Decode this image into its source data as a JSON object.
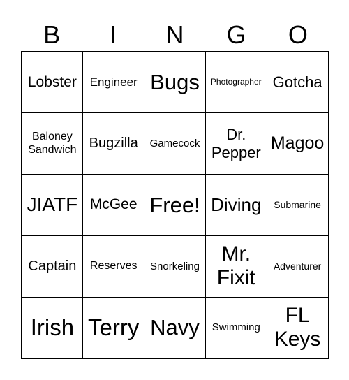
{
  "header": [
    "B",
    "I",
    "N",
    "G",
    "O"
  ],
  "cells": [
    "Lobster",
    "Engineer",
    "Bugs",
    "Photographer",
    "Gotcha",
    "Baloney Sandwich",
    "Bugzilla",
    "Gamecock",
    "Dr. Pepper",
    "Magoo",
    "JIATF",
    "McGee",
    "Free!",
    "Diving",
    "Submarine",
    "Captain",
    "Reserves",
    "Snorkeling",
    "Mr. Fixit",
    "Adventurer",
    "Irish",
    "Terry",
    "Navy",
    "Swimming",
    "FL Keys"
  ]
}
